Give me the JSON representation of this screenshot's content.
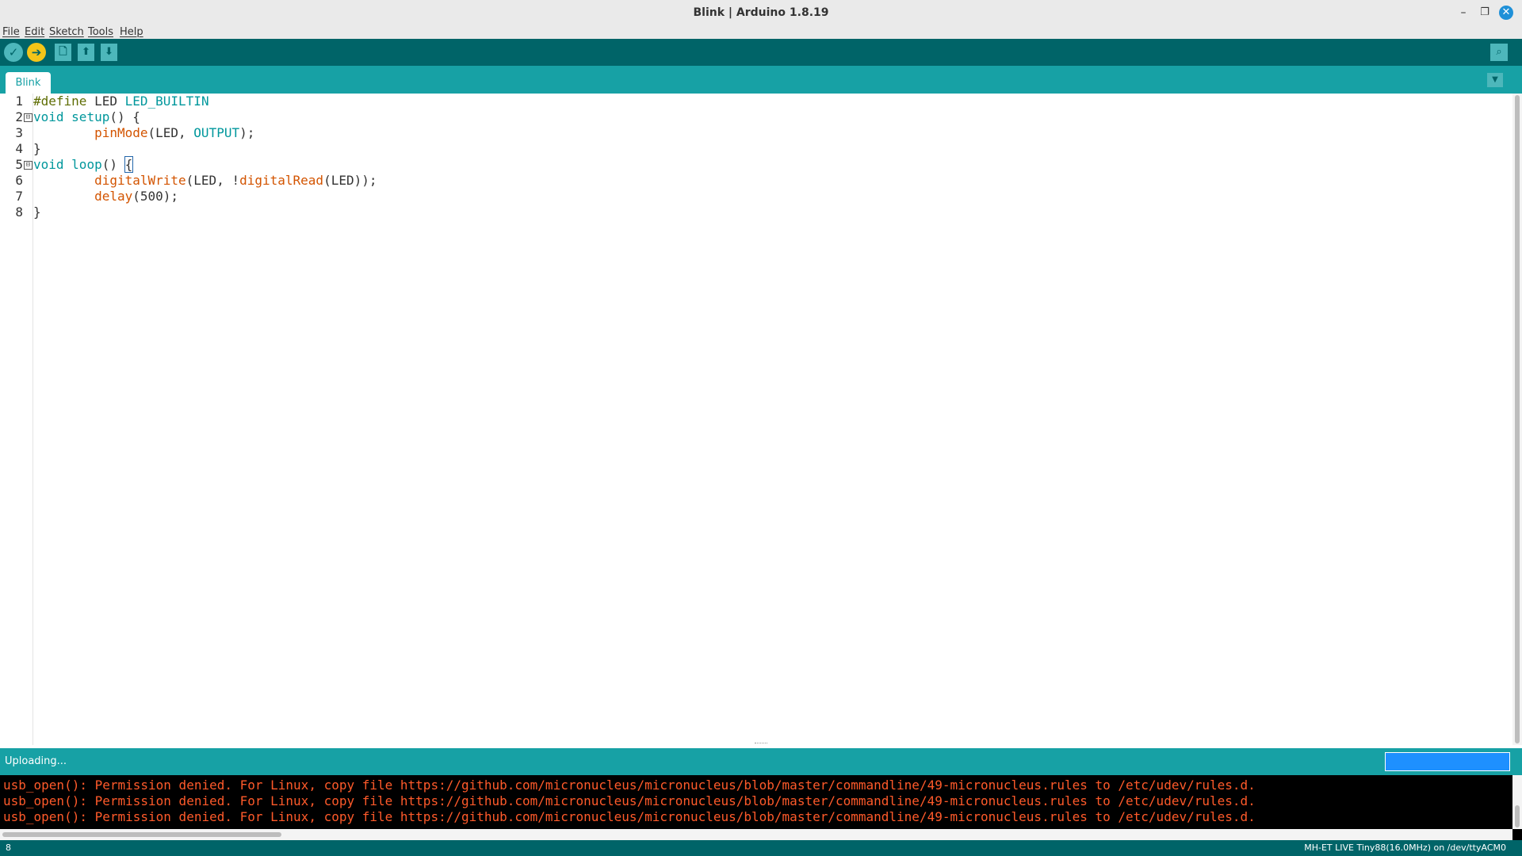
{
  "window": {
    "title": "Blink | Arduino 1.8.19",
    "controls": {
      "minimize": "–",
      "maximize": "❐",
      "close": "✕"
    }
  },
  "menu": {
    "items": [
      "File",
      "Edit",
      "Sketch",
      "Tools",
      "Help"
    ]
  },
  "toolbar": {
    "verify_icon": "check-icon",
    "upload_icon": "arrow-right-icon",
    "new_icon": "document-icon",
    "open_icon": "arrow-up-icon",
    "save_icon": "arrow-down-icon",
    "serial_monitor_icon": "magnifier-icon",
    "verify_glyph": "✓",
    "upload_glyph": "➔",
    "new_glyph": "🗋",
    "open_glyph": "⬆",
    "save_glyph": "⬇",
    "serial_glyph": "⌕"
  },
  "tabs": {
    "items": [
      "Blink"
    ],
    "menu_glyph": "▼"
  },
  "editor": {
    "line_numbers": [
      "1",
      "2",
      "3",
      "4",
      "5",
      "6",
      "7",
      "8"
    ],
    "fold_marker": "⊟",
    "lines": {
      "l1": {
        "a": "#define",
        "b": " LED ",
        "c": "LED_BUILTIN"
      },
      "l2": {
        "a": "void",
        "b": " ",
        "c": "setup",
        "d": "() {"
      },
      "l3": {
        "indent": "        ",
        "a": "pinMode",
        "b": "(LED, ",
        "c": "OUTPUT",
        "d": ");"
      },
      "l4": {
        "a": "}"
      },
      "l5": {
        "a": "void",
        "b": " ",
        "c": "loop",
        "d": "() ",
        "e": "{"
      },
      "l6": {
        "indent": "        ",
        "a": "digitalWrite",
        "b": "(LED, !",
        "c": "digitalRead",
        "d": "(LED));"
      },
      "l7": {
        "indent": "        ",
        "a": "delay",
        "b": "(500);"
      },
      "l8": {
        "a": "}"
      }
    }
  },
  "status": {
    "message": "Uploading...",
    "progress": 0
  },
  "console": {
    "lines": [
      "usb_open(): Permission denied. For Linux, copy file https://github.com/micronucleus/micronucleus/blob/master/commandline/49-micronucleus.rules to /etc/udev/rules.d.",
      "usb_open(): Permission denied. For Linux, copy file https://github.com/micronucleus/micronucleus/blob/master/commandline/49-micronucleus.rules to /etc/udev/rules.d.",
      "usb_open(): Permission denied. For Linux, copy file https://github.com/micronucleus/micronucleus/blob/master/commandline/49-micronucleus.rules to /etc/udev/rules.d."
    ]
  },
  "footer": {
    "line": "8",
    "board": "MH-ET LIVE Tiny88(16.0MHz) on /dev/ttyACM0"
  },
  "colors": {
    "toolbar": "#006468",
    "tabbar": "#17a1a5",
    "upload_button": "#f5c518",
    "console_text": "#ff5a2a",
    "keyword": "#00979c",
    "function": "#d35400"
  }
}
